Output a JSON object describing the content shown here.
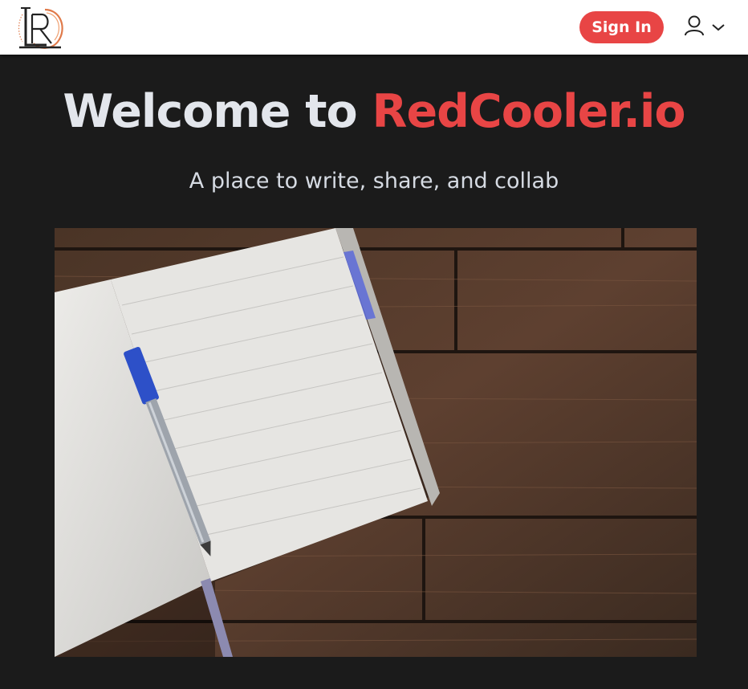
{
  "header": {
    "logo_letters": "RC",
    "signin_label": "Sign In",
    "user_icon": "user-icon",
    "dropdown_icon": "chevron-down-icon"
  },
  "hero": {
    "title_prefix": "Welcome to ",
    "title_brand": "RedCooler.io",
    "tagline": "A place to write, share, and collab",
    "image_alt": "Open notebook with a blue pen on a wooden table"
  },
  "colors": {
    "accent": "#e84545",
    "background": "#1b1b1b",
    "header_bg": "#ffffff",
    "heading_text": "#e3e6ec"
  }
}
